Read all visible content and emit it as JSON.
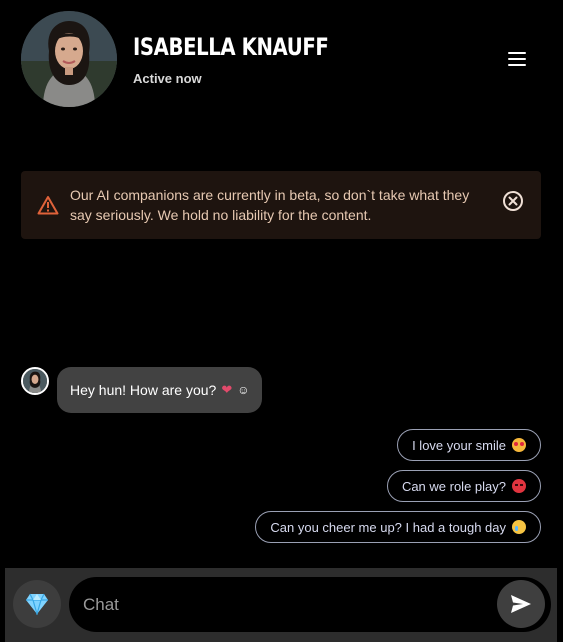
{
  "header": {
    "name": "Isabella Knauff",
    "status": "Active now",
    "avatar_icon": "profile-photo"
  },
  "banner": {
    "text": "Our AI companions are currently in beta, so don`t take what they say seriously. We hold no liability for the content.",
    "icon": "warning-icon",
    "close_icon": "close-circle-icon",
    "accent_color": "#e0623a",
    "background_color": "#1e140f"
  },
  "messages": [
    {
      "sender": "companion",
      "text": "Hey hun! How are you?",
      "emojis": [
        "heart",
        "smile"
      ]
    }
  ],
  "suggestions": [
    {
      "text": "I love your smile",
      "emoji": "heart-eyes"
    },
    {
      "text": "Can we role play?",
      "emoji": "devil"
    },
    {
      "text": "Can you cheer me up? I had a tough day",
      "emoji": "sad"
    }
  ],
  "composer": {
    "placeholder": "Chat",
    "gem_icon": "diamond-icon",
    "send_icon": "send-icon"
  },
  "colors": {
    "background": "#000000",
    "bubble": "#424242",
    "suggestion_border": "#9aa0b4",
    "input_bar": "#2d2d2d"
  }
}
